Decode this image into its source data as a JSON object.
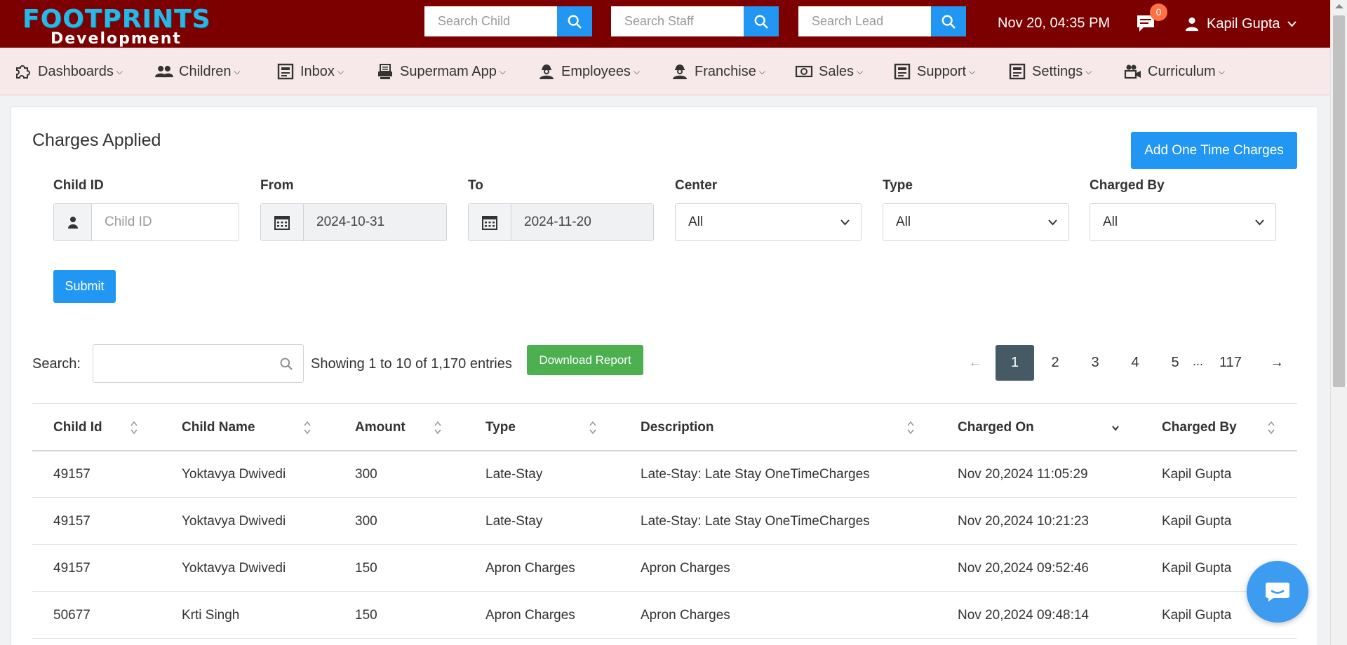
{
  "app": {
    "logo_main": "FOOTPRINTS",
    "logo_sub": "Development",
    "datetime": "Nov 20, 04:35 PM",
    "chat_count": "0",
    "user_name": "Kapil Gupta"
  },
  "header_search": [
    {
      "placeholder": "Search Child",
      "icon": "search-icon"
    },
    {
      "placeholder": "Search Staff",
      "icon": "search-icon"
    },
    {
      "placeholder": "Search Lead",
      "icon": "search-icon"
    }
  ],
  "nav": [
    {
      "label": "Dashboards",
      "icon": "puzzle-icon"
    },
    {
      "label": "Children",
      "icon": "users-icon"
    },
    {
      "label": "Inbox",
      "icon": "form-icon"
    },
    {
      "label": "Supermam App",
      "icon": "printer-icon"
    },
    {
      "label": "Employees",
      "icon": "worker-icon"
    },
    {
      "label": "Franchise",
      "icon": "worker-icon"
    },
    {
      "label": "Sales",
      "icon": "money-icon"
    },
    {
      "label": "Support",
      "icon": "form-icon"
    },
    {
      "label": "Settings",
      "icon": "form-icon"
    },
    {
      "label": "Curriculum",
      "icon": "video-user-icon"
    }
  ],
  "page": {
    "title": "Charges Applied",
    "add_button": "Add One Time Charges",
    "submit_button": "Submit"
  },
  "filters": {
    "child_id": {
      "label": "Child ID",
      "placeholder": "Child ID",
      "value": ""
    },
    "from": {
      "label": "From",
      "value": "2024-10-31"
    },
    "to": {
      "label": "To",
      "value": "2024-11-20"
    },
    "center": {
      "label": "Center",
      "value": "All"
    },
    "type": {
      "label": "Type",
      "value": "All"
    },
    "charged_by": {
      "label": "Charged By",
      "value": "All"
    }
  },
  "table_tools": {
    "search_label": "Search:",
    "search_value": "",
    "showing": "Showing 1 to 10 of 1,170 entries",
    "download_button": "Download Report"
  },
  "pagination": {
    "prev": "←",
    "pages": [
      "1",
      "2",
      "3",
      "4",
      "5"
    ],
    "ellipsis": "...",
    "last": "117",
    "next": "→",
    "active": "1"
  },
  "table": {
    "columns": [
      "Child Id",
      "Child Name",
      "Amount",
      "Type",
      "Description",
      "Charged On",
      "Charged By"
    ],
    "sorted_column": "Charged On",
    "sort_direction": "descending",
    "rows": [
      [
        "49157",
        "Yoktavya Dwivedi",
        "300",
        "Late-Stay",
        "Late-Stay: Late Stay OneTimeCharges",
        "Nov 20,2024 11:05:29",
        "Kapil Gupta"
      ],
      [
        "49157",
        "Yoktavya Dwivedi",
        "300",
        "Late-Stay",
        "Late-Stay: Late Stay OneTimeCharges",
        "Nov 20,2024 10:21:23",
        "Kapil Gupta"
      ],
      [
        "49157",
        "Yoktavya Dwivedi",
        "150",
        "Apron Charges",
        "Apron Charges",
        "Nov 20,2024 09:52:46",
        "Kapil Gupta"
      ],
      [
        "50677",
        "Krti Singh",
        "150",
        "Apron Charges",
        "Apron Charges",
        "Nov 20,2024 09:48:14",
        "Kapil Gupta"
      ]
    ]
  },
  "colors": {
    "header_bg": "#7d0000",
    "nav_bg": "#f7e9e9",
    "primary": "#2196f3",
    "success": "#4caf50",
    "badge": "#ff7043",
    "page_active": "#455a64"
  }
}
